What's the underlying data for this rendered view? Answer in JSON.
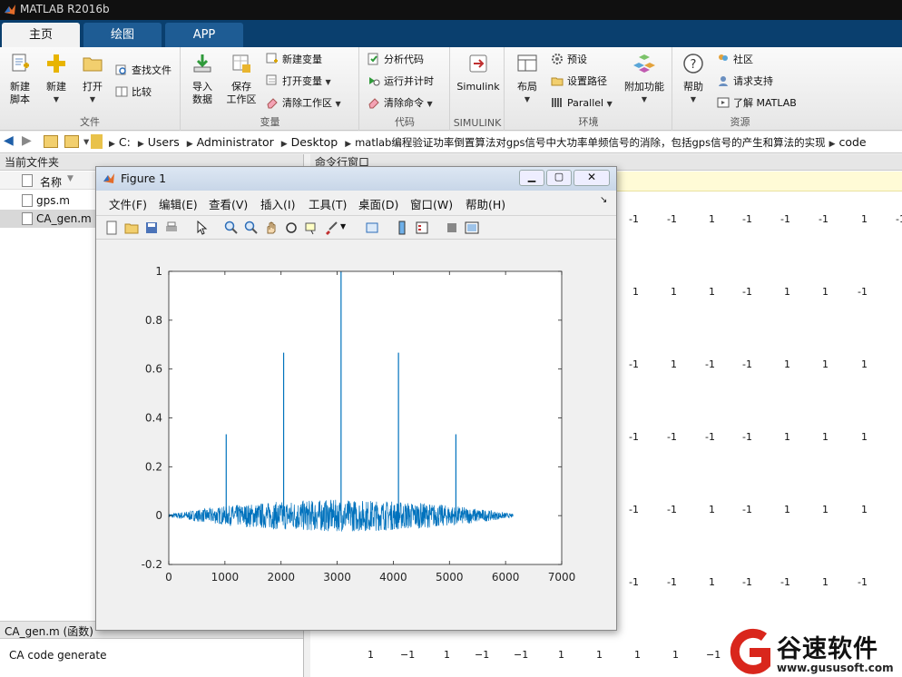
{
  "app": {
    "title": "MATLAB R2016b"
  },
  "tabs": [
    {
      "label": "主页"
    },
    {
      "label": "绘图"
    },
    {
      "label": "APP"
    }
  ],
  "ribbon": {
    "file": {
      "label": "文件",
      "new_script": "新建\n脚本",
      "new": "新建",
      "open": "打开",
      "find_files": "查找文件",
      "compare": "比较"
    },
    "variable": {
      "label": "变量",
      "import": "导入\n数据",
      "save_ws": "保存\n工作区",
      "new_var": "新建变量",
      "open_var": "打开变量",
      "clear_ws": "清除工作区"
    },
    "code": {
      "label": "代码",
      "analyze": "分析代码",
      "run_time": "运行并计时",
      "clear_cmd": "清除命令"
    },
    "simulink": {
      "label": "SIMULINK",
      "simulink": "Simulink"
    },
    "env": {
      "label": "环境",
      "layout": "布局",
      "prefs": "预设",
      "set_path": "设置路径",
      "parallel": "Parallel",
      "addons": "附加功能"
    },
    "resources": {
      "label": "资源",
      "help": "帮助",
      "community": "社区",
      "support": "请求支持",
      "learn": "了解 MATLAB"
    }
  },
  "address": {
    "parts": [
      "C:",
      "Users",
      "Administrator",
      "Desktop",
      "matlab编程验证功率倒置算法对gps信号中大功率单频信号的消除，包括gps信号的产生和算法的实现",
      "code"
    ]
  },
  "left": {
    "header": "当前文件夹",
    "col_name": "名称",
    "files": [
      {
        "name": "gps.m"
      },
      {
        "name": "CA_gen.m"
      }
    ],
    "details_header": "CA_gen.m  (函数)",
    "details_text": "CA code generate"
  },
  "command": {
    "header": "命令行窗口",
    "rows": [
      {
        "y": 241,
        "vals": [
          "-1",
          "-1",
          "1",
          "-1",
          "-1",
          "-1",
          "1",
          "-1"
        ]
      },
      {
        "y": 321,
        "vals": [
          "1",
          "1",
          "1",
          "-1",
          "1",
          "1",
          "-1"
        ]
      },
      {
        "y": 401,
        "vals": [
          "-1",
          "1",
          "-1",
          "-1",
          "1",
          "1",
          "1"
        ]
      },
      {
        "y": 481,
        "vals": [
          "-1",
          "-1",
          "-1",
          "-1",
          "1",
          "1",
          "1"
        ]
      },
      {
        "y": 561,
        "vals": [
          "-1",
          "-1",
          "1",
          "-1",
          "1",
          "1",
          "1"
        ]
      },
      {
        "y": 641,
        "vals": [
          "-1",
          "-1",
          "1",
          "-1",
          "-1",
          "1",
          "-1"
        ]
      }
    ],
    "last_row": [
      "1",
      "−1",
      "1",
      "−1",
      "−1",
      "1",
      "1",
      "1",
      "1",
      "−1"
    ]
  },
  "figure": {
    "title": "Figure 1",
    "menu": [
      "文件(F)",
      "编辑(E)",
      "查看(V)",
      "插入(I)",
      "工具(T)",
      "桌面(D)",
      "窗口(W)",
      "帮助(H)"
    ]
  },
  "chart_data": {
    "type": "line",
    "title": "",
    "xlabel": "",
    "ylabel": "",
    "xlim": [
      0,
      7000
    ],
    "ylim": [
      -0.2,
      1
    ],
    "xticks": [
      "0",
      "1000",
      "2000",
      "3000",
      "4000",
      "5000",
      "6000",
      "7000"
    ],
    "yticks": [
      "-0.2",
      "0",
      "0.2",
      "0.4",
      "0.6",
      "0.8",
      "1"
    ],
    "series": [
      {
        "color": "#0072bd",
        "peaks": [
          {
            "x": 1023,
            "y": 0.333
          },
          {
            "x": 2046,
            "y": 0.667
          },
          {
            "x": 3069,
            "y": 1.0
          },
          {
            "x": 4092,
            "y": 0.667
          },
          {
            "x": 5115,
            "y": 0.333
          }
        ],
        "x_start": 0,
        "x_end": 6137,
        "noise_envelope_max": 0.065
      }
    ],
    "grid": false
  },
  "watermark": {
    "brand": "谷速软件",
    "url": "www.gususoft.com",
    "color": "#d9261c"
  }
}
